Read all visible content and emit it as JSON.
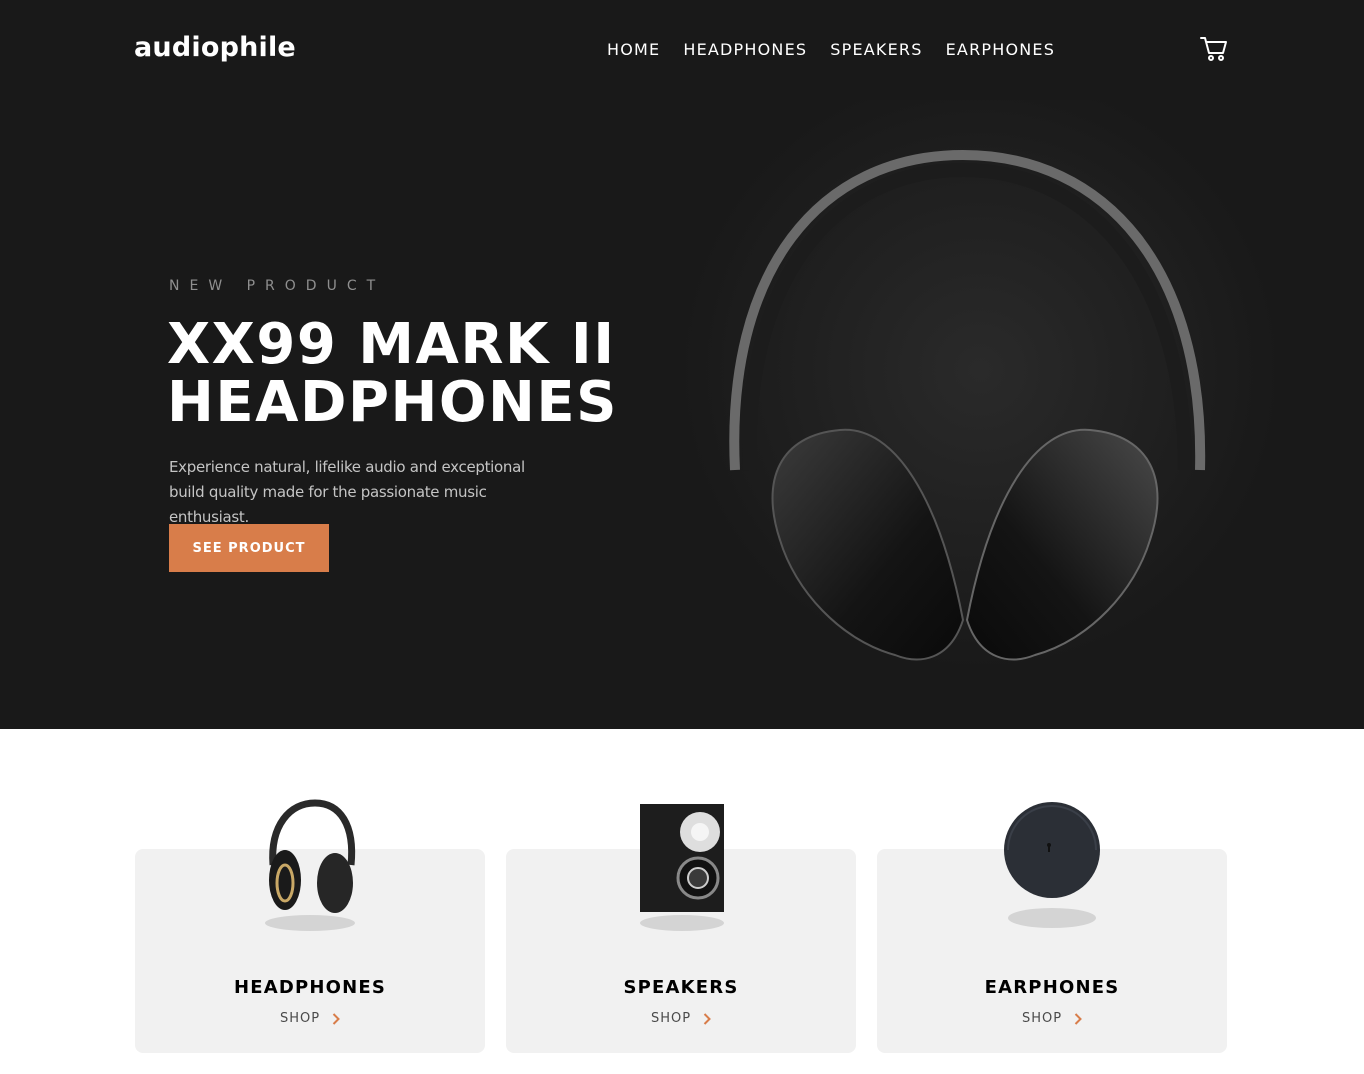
{
  "header": {
    "logo": "audiophile",
    "nav": [
      "HOME",
      "HEADPHONES",
      "SPEAKERS",
      "EARPHONES"
    ],
    "cart_icon": "cart-icon"
  },
  "hero": {
    "overline": "NEW PRODUCT",
    "title_line1": "XX99 MARK II",
    "title_line2": "HEADPHONES",
    "description": "Experience natural, lifelike audio and exceptional build quality made for the passionate music enthusiast.",
    "cta": "SEE PRODUCT"
  },
  "categories": [
    {
      "name": "HEADPHONES",
      "shop": "SHOP"
    },
    {
      "name": "SPEAKERS",
      "shop": "SHOP"
    },
    {
      "name": "EARPHONES",
      "shop": "SHOP"
    }
  ],
  "colors": {
    "accent": "#d87d4a",
    "hero_bg": "#191919",
    "card_bg": "#f1f1f1"
  }
}
